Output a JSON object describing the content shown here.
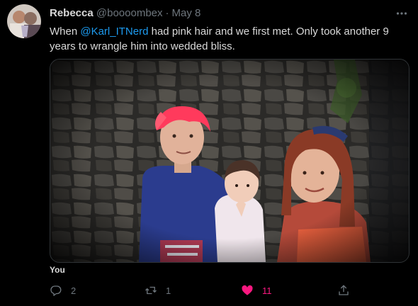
{
  "tweet": {
    "author_name": "Rebecca",
    "handle": "@boooombex",
    "separator": "·",
    "date": "May 8",
    "text_before": "When ",
    "mention": "@Karl_ITNerd",
    "text_after": " had pink hair and we first met. Only took another 9 years to wrangle him into wedded bliss.",
    "liked_by": "You"
  },
  "actions": {
    "reply_count": "2",
    "retweet_count": "1",
    "like_count": "11",
    "liked": true
  },
  "colors": {
    "accent_blue": "#1d9bf0",
    "like_pink": "#f91880",
    "muted": "#6e767d"
  },
  "icons": [
    "more-icon",
    "reply-icon",
    "retweet-icon",
    "heart-icon",
    "share-icon"
  ]
}
